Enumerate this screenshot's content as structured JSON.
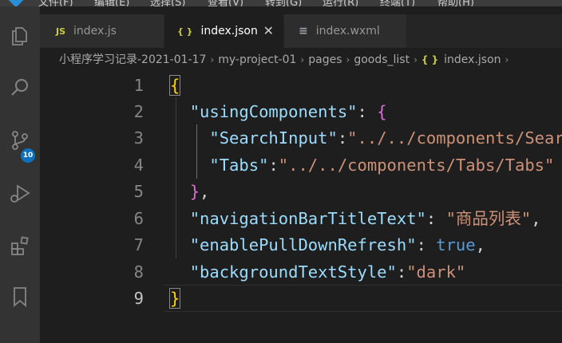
{
  "menubar": {
    "items": [
      "文件(F)",
      "编辑(E)",
      "选择(S)",
      "查看(V)",
      "转到(G)",
      "运行(R)",
      "终端(T)",
      "帮助(H)"
    ]
  },
  "activity_bar": {
    "items": [
      {
        "name": "explorer-icon"
      },
      {
        "name": "search-icon"
      },
      {
        "name": "source-control-icon",
        "badge": "10"
      },
      {
        "name": "run-debug-icon"
      },
      {
        "name": "extensions-icon"
      },
      {
        "name": "bookmark-icon"
      }
    ]
  },
  "tabs": [
    {
      "icon_text": "JS",
      "label": "index.js",
      "active": false
    },
    {
      "icon_text": "{ }",
      "label": "index.json",
      "active": true,
      "close": "✕"
    },
    {
      "icon_text": "≡",
      "label": "index.wxml",
      "active": false
    }
  ],
  "breadcrumb": {
    "parts": [
      "小程序学习记录-2021-01-17",
      "my-project-01",
      "pages",
      "goods_list"
    ],
    "file_icon": "{ }",
    "file": "index.json",
    "trailing_sep": "›",
    "sep": "›"
  },
  "editor": {
    "line_numbers": [
      "1",
      "2",
      "3",
      "4",
      "5",
      "6",
      "7",
      "8",
      "9"
    ],
    "active_line": "9",
    "tokens": {
      "l1_brace": "{",
      "l2_key": "\"usingComponents\"",
      "l2_colon": ": ",
      "l2_brace": "{",
      "l3_key": "\"SearchInput\"",
      "l3_colon": ":",
      "l3_val": "\"../../components/SearchInput/SearchInput\"",
      "l4_key": "\"Tabs\"",
      "l4_colon": ":",
      "l4_val": "\"../../components/Tabs/Tabs\"",
      "l5_brace": "}",
      "l5_comma": ",",
      "l6_key": "\"navigationBarTitleText\"",
      "l6_colon": ": ",
      "l6_val": "\"商品列表\"",
      "l6_comma": ",",
      "l7_key": "\"enablePullDownRefresh\"",
      "l7_colon": ": ",
      "l7_val": "true",
      "l7_comma": ",",
      "l8_key": "\"backgroundTextStyle\"",
      "l8_colon": ":",
      "l8_val": "\"dark\"",
      "l9_brace": "}"
    }
  },
  "colors": {
    "background": "#1e1e1e",
    "key": "#9cdcfe",
    "string": "#ce9178",
    "keyword": "#569cd6",
    "bracket_level1": "#ffd700",
    "bracket_level2": "#da70d6",
    "badge": "#0e6fbd"
  }
}
